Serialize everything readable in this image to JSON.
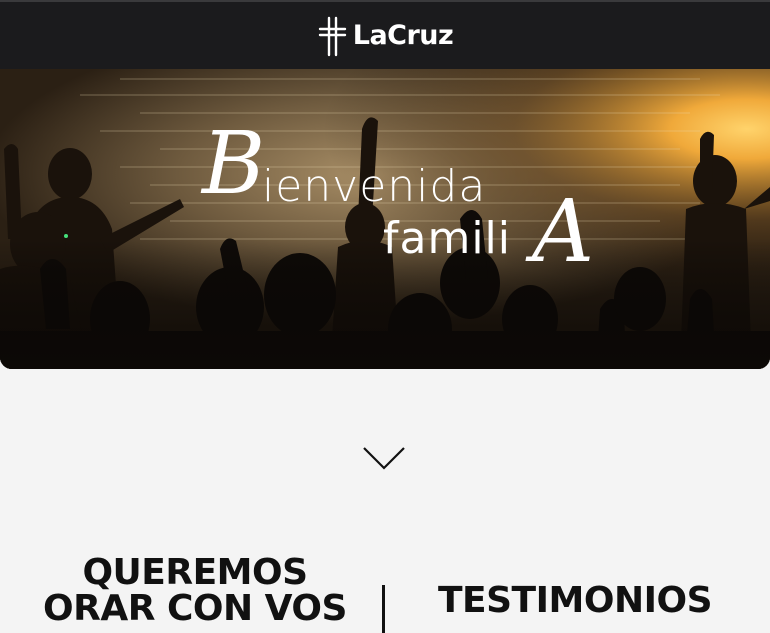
{
  "header": {
    "logo_text": "LaCruz",
    "logo_icon": "cross-icon",
    "background": "#1b1b1d"
  },
  "hero": {
    "title_line1_initial": "B",
    "title_line1_rest": "ienvenida",
    "title_line2_start": "famili",
    "title_line2_final": "A",
    "accent": "#e3a73c"
  },
  "scroll_indicator": {
    "icon": "chevron-down-icon"
  },
  "links": {
    "pray_line1": "QUEREMOS",
    "pray_line2": "ORAR CON VOS",
    "testimonials": "TESTIMONIOS"
  }
}
